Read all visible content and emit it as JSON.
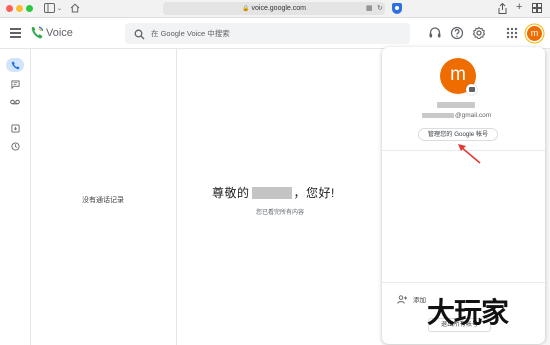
{
  "browser": {
    "url": "voice.google.com"
  },
  "app": {
    "title": "Voice",
    "search_placeholder": "在 Google Voice 中搜索",
    "avatar_letter": "m"
  },
  "colors": {
    "accent": "#1a73e8",
    "voice_green": "#34a853",
    "avatar_orange": "#ef6c00",
    "arrow_red": "#e53935"
  },
  "rail": {
    "items": [
      {
        "icon": "phone-icon",
        "active": true
      },
      {
        "icon": "message-icon",
        "active": false
      },
      {
        "icon": "voicemail-icon",
        "active": false
      },
      {
        "icon": "archive-icon",
        "active": false
      },
      {
        "icon": "history-icon",
        "active": false
      }
    ]
  },
  "calls": {
    "empty_text": "没有通话记录"
  },
  "main": {
    "greeting_prefix": "尊敬的",
    "greeting_suffix": "，您好!",
    "caught_up": "您已看完所有内容"
  },
  "account": {
    "avatar_letter": "m",
    "email_domain": "@gmail.com",
    "manage_label": "管理您的 Google 帐号",
    "add_account_label": "添加",
    "sign_out_label": "退出所有帐号"
  },
  "watermark": "大玩家"
}
